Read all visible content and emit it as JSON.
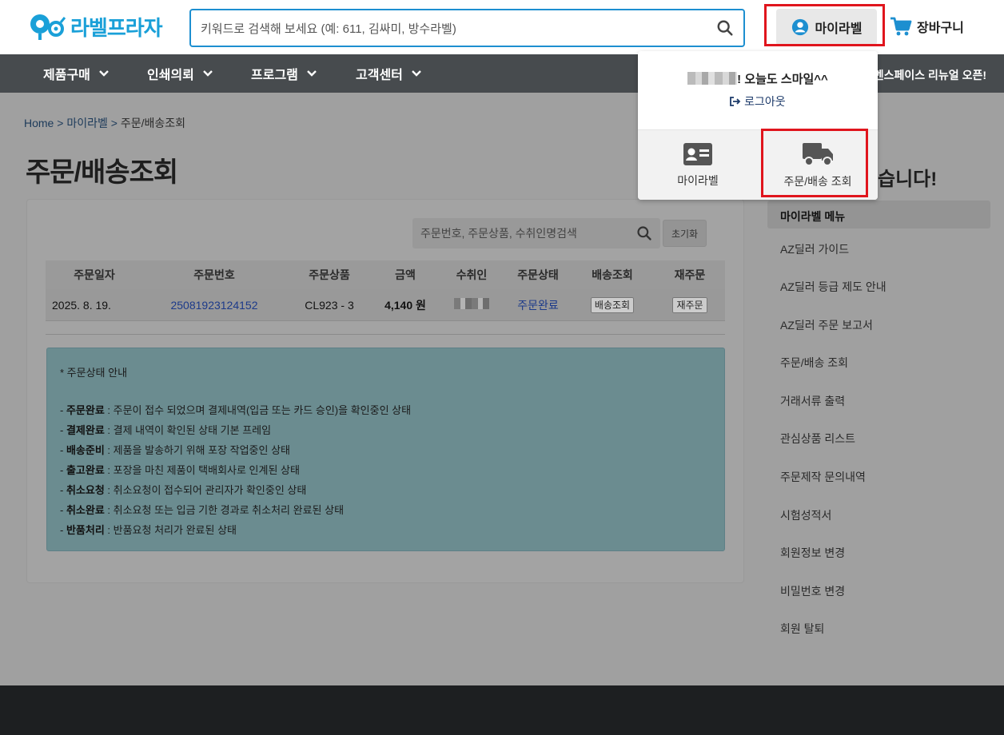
{
  "brand": {
    "logo_text": "라벨프라자",
    "accent": "#1aa0d8"
  },
  "header": {
    "search_placeholder": "키워드로 검색해 보세요 (예: 611, 김싸미, 방수라벨)",
    "mylabel_label": "마이라벨",
    "cart_label": "장바구니"
  },
  "nav": {
    "items": [
      {
        "label": "제품구매"
      },
      {
        "label": "인쇄의뢰"
      },
      {
        "label": "프로그램"
      },
      {
        "label": "고객센터"
      }
    ],
    "notice": "멘스페이스 리뉴얼 오픈!"
  },
  "breadcrumb": {
    "home": "Home",
    "sep1": ">",
    "parent": "마이라벨",
    "sep2": ">",
    "current": "주문/배송조회"
  },
  "page_title": "주문/배송조회",
  "order_search": {
    "placeholder": "주문번호, 주문상품, 수취인명검색",
    "reset_label": "초기화"
  },
  "table": {
    "headers": [
      "주문일자",
      "주문번호",
      "주문상품",
      "금액",
      "수취인",
      "주문상태",
      "배송조회",
      "재주문"
    ],
    "rows": [
      {
        "date": "2025. 8. 19.",
        "order_no": "25081923124152",
        "product": "CL923 - 3",
        "amount": "4,140 원",
        "status": "주문완료",
        "track_label": "배송조회",
        "reorder_label": "재주문"
      }
    ]
  },
  "guide": {
    "title": "* 주문상태 안내",
    "lines": [
      {
        "term": "주문완료",
        "desc": " : 주문이 접수 되었으며 결제내역(입금 또는 카드 승인)을 확인중인 상태"
      },
      {
        "term": "결제완료",
        "desc": " : 결제 내역이 확인된 상태 기본 프레임"
      },
      {
        "term": "배송준비",
        "desc": " : 제품을 발송하기 위해 포장 작업중인 상태"
      },
      {
        "term": "출고완료",
        "desc": " : 포장을 마친 제품이 택배회사로 인계된 상태"
      },
      {
        "term": "취소요청",
        "desc": " : 취소요청이 접수되어 관리자가 확인중인 상태"
      },
      {
        "term": "취소완료",
        "desc": " : 취소요청 또는 입금 기한 경과로 취소처리 완료된 상태"
      },
      {
        "term": "반품처리",
        "desc": " : 반품요청 처리가 완료된 상태"
      }
    ]
  },
  "sidebar": {
    "title_fragment": "습니다!",
    "menu_head": "마이라벨 메뉴",
    "items": [
      {
        "label": "AZ딜러 가이드"
      },
      {
        "label": "AZ딜러 등급 제도 안내"
      },
      {
        "label": "AZ딜러 주문 보고서"
      },
      {
        "label": "주문/배송 조회"
      },
      {
        "label": "거래서류 출력"
      },
      {
        "label": "관심상품 리스트"
      },
      {
        "label": "주문제작 문의내역"
      },
      {
        "label": "시험성적서"
      },
      {
        "label": "회원정보 변경"
      },
      {
        "label": "비밀번호 변경"
      },
      {
        "label": "회원 탈퇴"
      }
    ]
  },
  "dropdown": {
    "greeting": "! 오늘도 스마일^^",
    "logout_label": "로그아웃",
    "cells": [
      {
        "label": "마이라벨",
        "icon": "id-card-icon"
      },
      {
        "label": "주문/배송 조회",
        "icon": "truck-icon"
      }
    ]
  },
  "colors": {
    "highlight": "#e0151d",
    "link": "#1c3a6a",
    "nav_bg": "#474b4e"
  }
}
